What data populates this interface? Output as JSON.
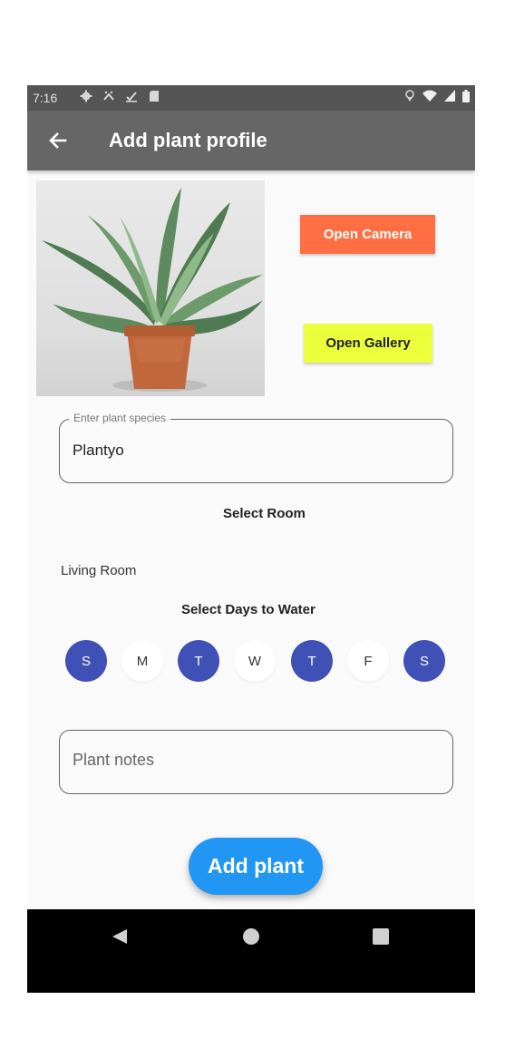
{
  "status_bar": {
    "time": "7:16",
    "left_icons": [
      "gear-icon",
      "cast-icon",
      "download-icon",
      "sd-card-icon"
    ],
    "right_icons": [
      "location-icon",
      "wifi-icon",
      "signal-icon",
      "battery-icon"
    ]
  },
  "app_bar": {
    "title": "Add plant profile",
    "back_icon": "arrow-back-icon",
    "color": "#666666"
  },
  "photo": {
    "subject": "potted plant"
  },
  "buttons": {
    "open_camera": "Open Camera",
    "open_gallery": "Open Gallery",
    "camera_color": "#ff6f43",
    "gallery_color": "#ebff3b"
  },
  "species_field": {
    "label": "Enter plant species",
    "value": "Plantyo"
  },
  "room": {
    "label": "Select Room",
    "value": "Living Room"
  },
  "watering": {
    "label": "Select Days to Water",
    "days": [
      {
        "letter": "S",
        "selected": true
      },
      {
        "letter": "M",
        "selected": false
      },
      {
        "letter": "T",
        "selected": true
      },
      {
        "letter": "W",
        "selected": false
      },
      {
        "letter": "T",
        "selected": true
      },
      {
        "letter": "F",
        "selected": false
      },
      {
        "letter": "S",
        "selected": true
      }
    ],
    "selected_color": "#3f51b5"
  },
  "notes_field": {
    "placeholder": "Plant notes",
    "value": ""
  },
  "add_button": {
    "label": "Add plant",
    "color": "#2196f3"
  },
  "nav_bar": {
    "icons": [
      "back-triangle-icon",
      "home-circle-icon",
      "recents-square-icon"
    ]
  }
}
